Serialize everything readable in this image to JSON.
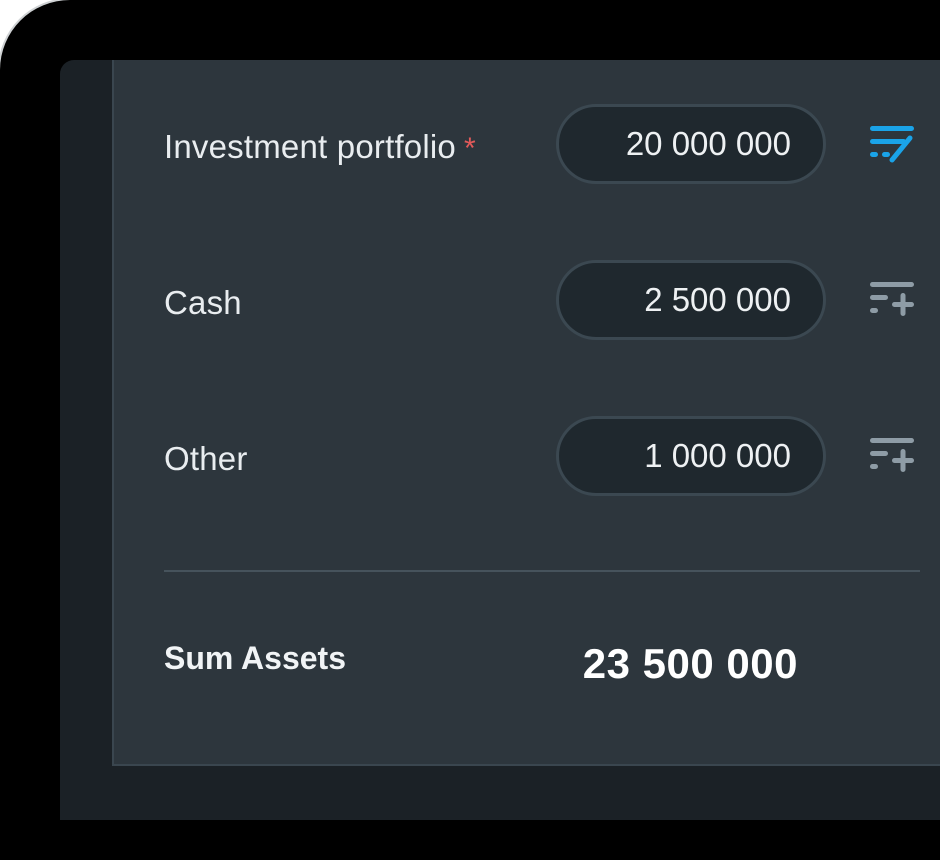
{
  "assets": {
    "rows": [
      {
        "label": "Investment portfolio",
        "required_mark": "*",
        "value": "20 000 000",
        "icon": "edit-list-icon",
        "icon_color": "#1aa3e8"
      },
      {
        "label": "Cash",
        "value": "2 500 000",
        "icon": "add-list-icon",
        "icon_color": "#8e9ca6"
      },
      {
        "label": "Other",
        "value": "1 000 000",
        "icon": "add-list-icon",
        "icon_color": "#8e9ca6"
      }
    ],
    "sum": {
      "label": "Sum Assets",
      "value": "23 500 000"
    }
  },
  "colors": {
    "panel_bg": "#2d363d",
    "field_bg": "#1f282e",
    "required": "#e25a5a",
    "accent": "#1aa3e8"
  }
}
